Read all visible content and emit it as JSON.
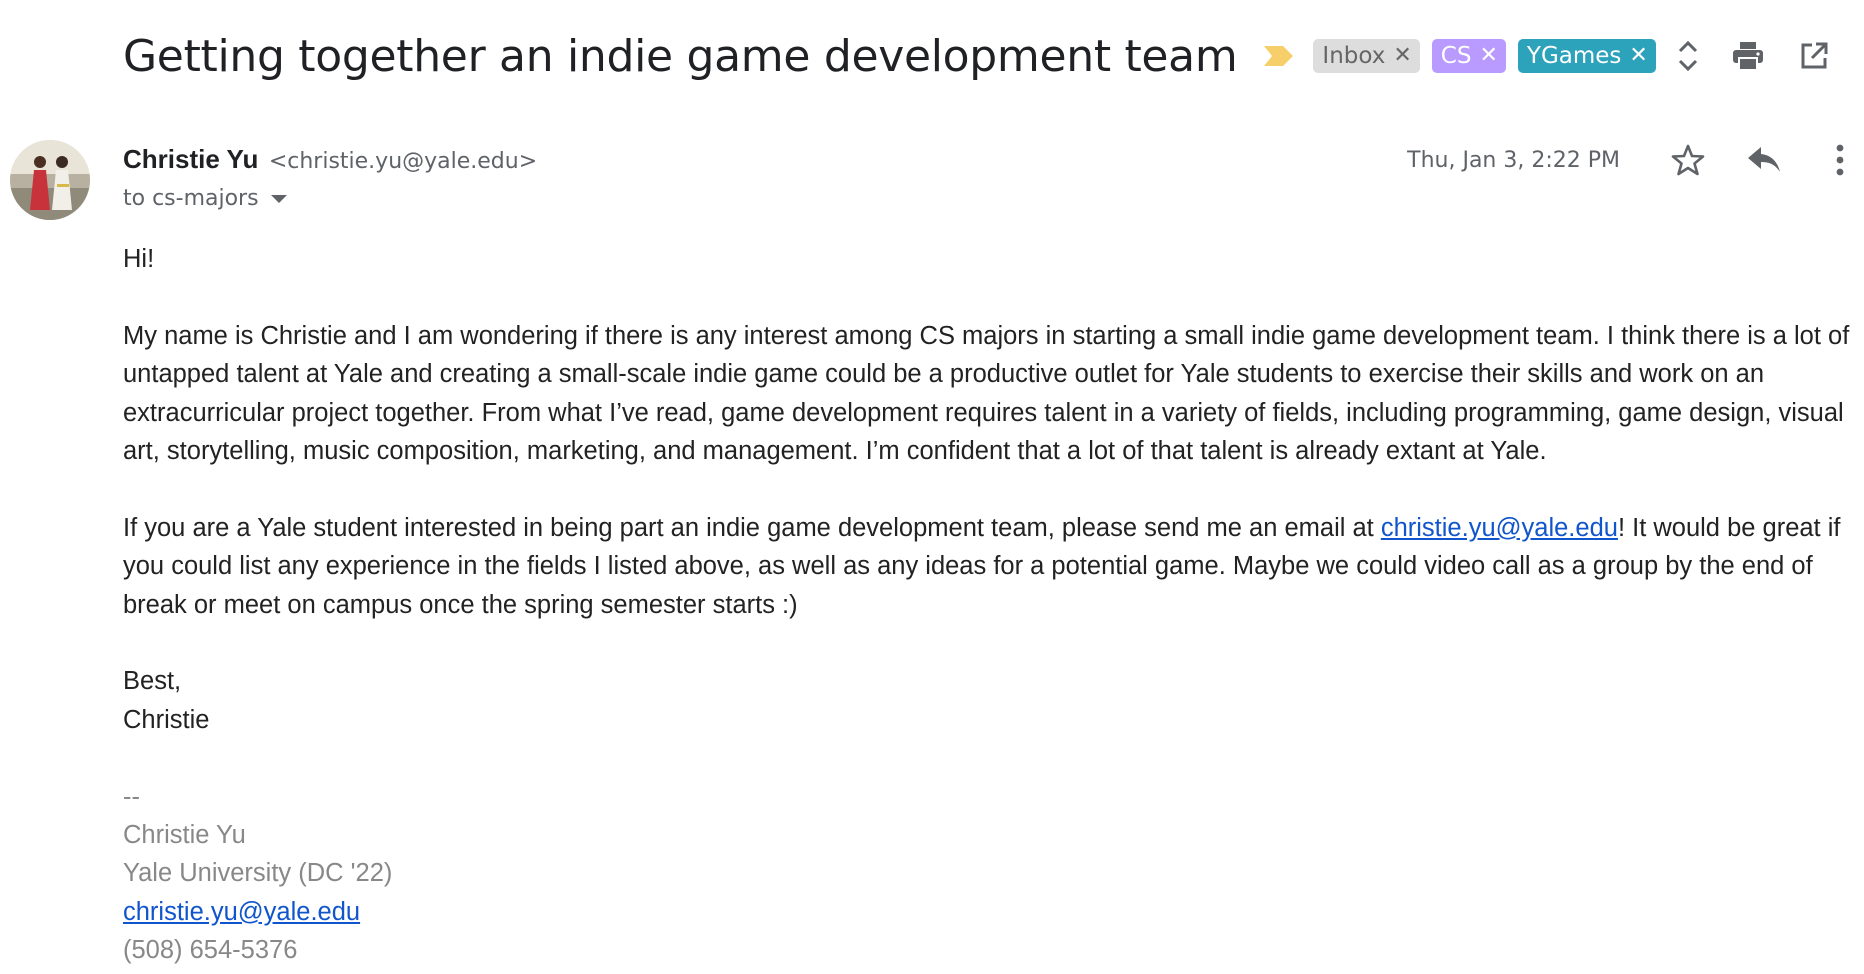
{
  "subject": "Getting together an indie game development team",
  "labels": [
    {
      "name": "Inbox",
      "bg": "#dddddd",
      "fg": "#666666"
    },
    {
      "name": "CS",
      "bg": "#b99aff",
      "fg": "#ffffff"
    },
    {
      "name": "YGames",
      "bg": "#2da2bb",
      "fg": "#ffffff"
    }
  ],
  "label_remove_glyph": "✕",
  "icons": {
    "importance": "importance-marker-icon",
    "expand": "expand-all-icon",
    "print": "print-icon",
    "new_window": "open-in-new-window-icon",
    "star": "star-icon",
    "reply": "reply-icon",
    "more": "more-vertical-icon"
  },
  "sender": {
    "name": "Christie Yu",
    "email": "<christie.yu@yale.edu>"
  },
  "recipient": "to cs-majors",
  "timestamp": "Thu, Jan 3, 2:22 PM",
  "body": {
    "greeting": "Hi!",
    "paragraph1": "My name is Christie and I am wondering if there is any interest among CS majors in starting a small indie game development team. I think there is a lot of untapped talent at Yale and creating a small-scale indie game could be a productive outlet for Yale students to exercise their skills and work on an extracurricular project together. From what I’ve read, game development requires talent in a variety of fields, including programming, game design, visual art, storytelling, music composition, marketing, and management. I’m confident that a lot of that talent is already extant at Yale.",
    "paragraph2_before": "If you are a Yale student interested in being part an indie game development team, please send me an email at ",
    "paragraph2_link": "christie.yu@yale.edu",
    "paragraph2_after": "! It would be great if you could list any experience in the fields I listed above, as well as any ideas for a potential game. Maybe we could video call as a group by the end of break or meet on campus once the spring semester starts :)",
    "closing": "Best,",
    "closing_name": "Christie"
  },
  "signature": {
    "separator": "--",
    "name": "Christie Yu",
    "school": "Yale University (DC '22)",
    "email": "christie.yu@yale.edu",
    "phone": "(508) 654-5376"
  },
  "colors": {
    "link": "#1155cc",
    "muted": "#5f6368",
    "signature": "#888888",
    "importance": "#f6cf6a"
  }
}
